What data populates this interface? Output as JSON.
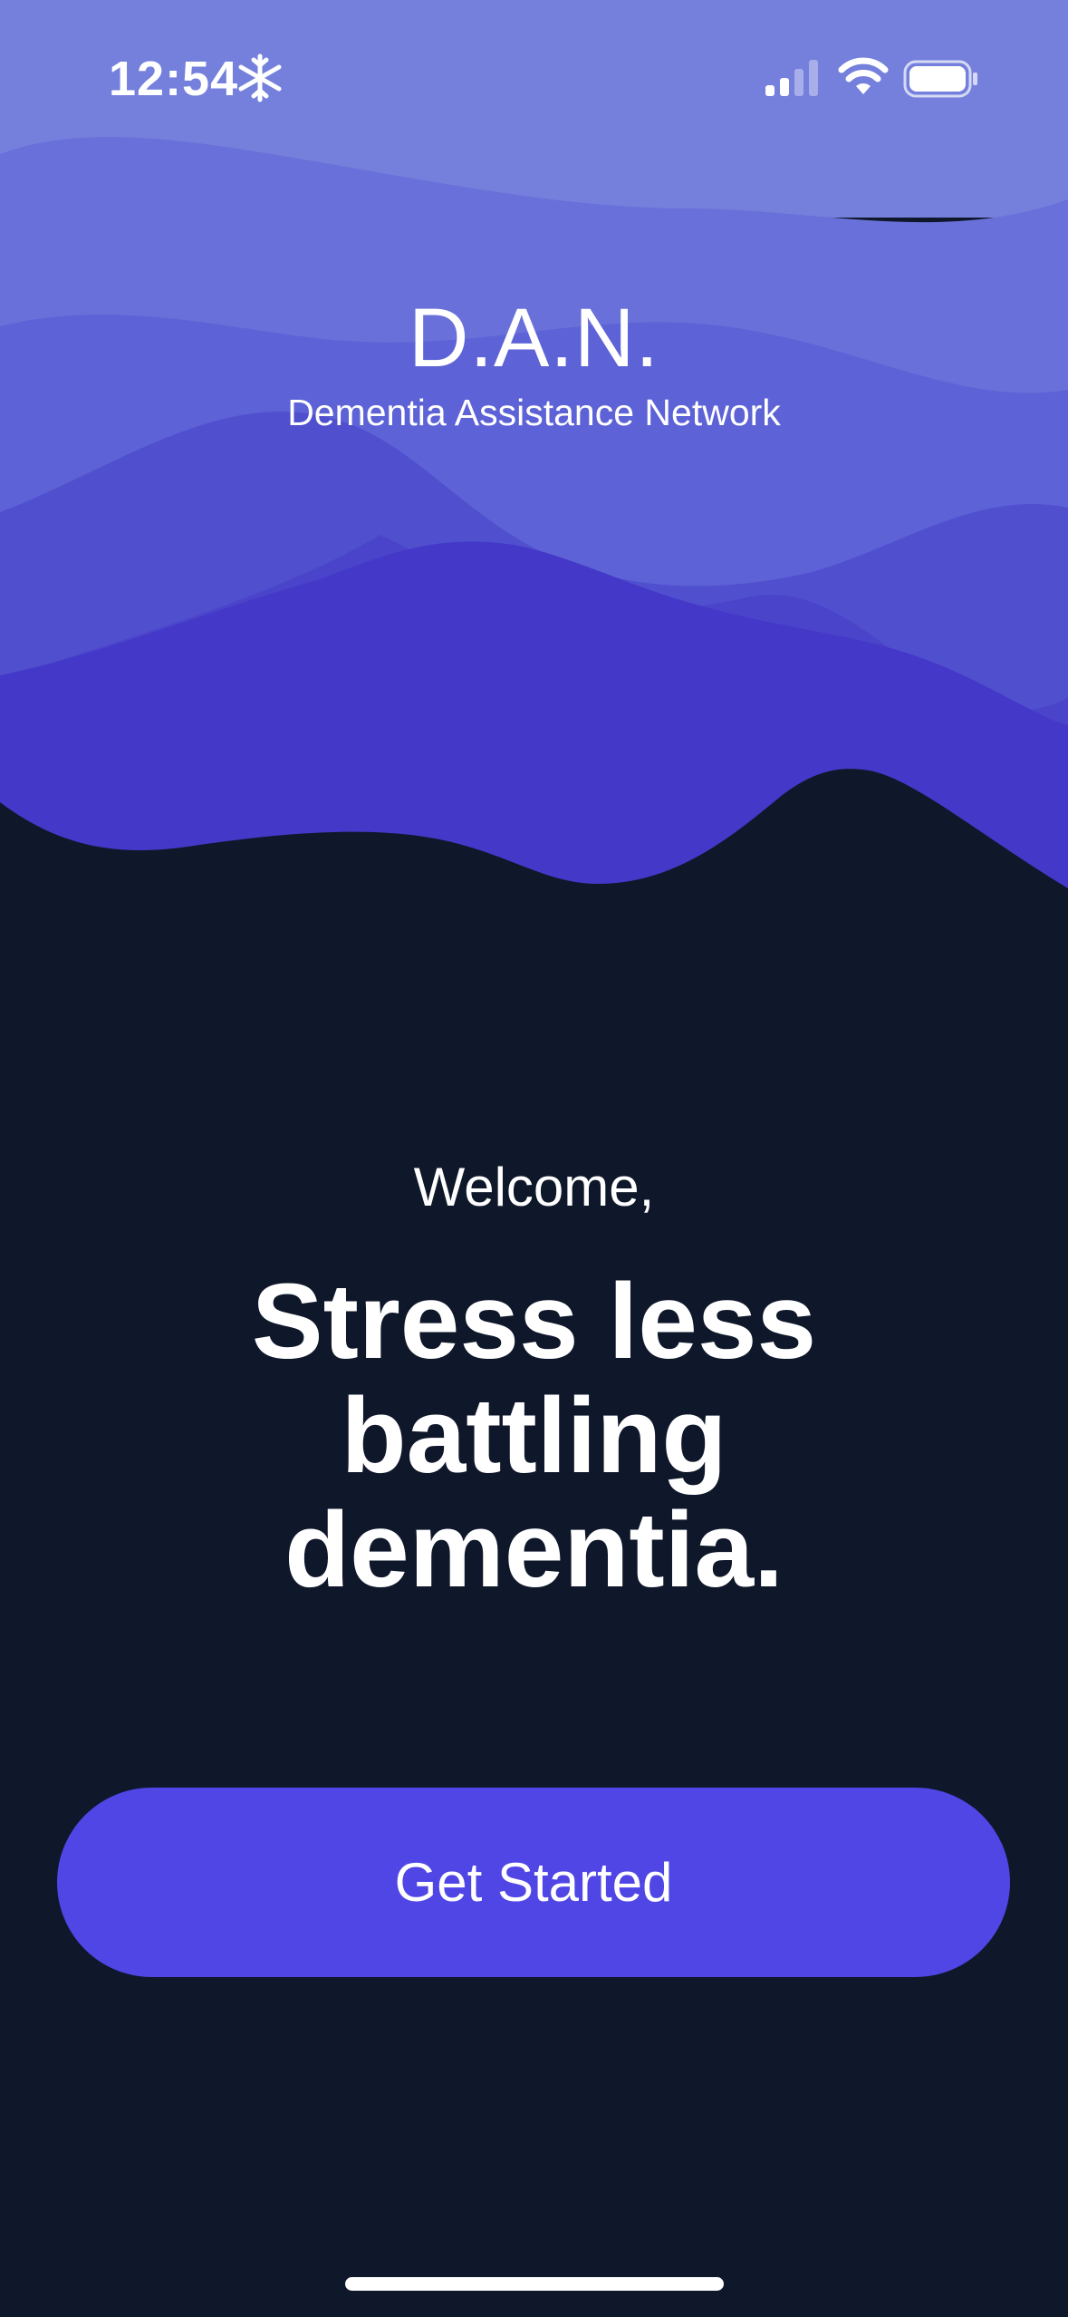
{
  "status_bar": {
    "time": "12:54",
    "time_suffix_icon": "snowflake-icon",
    "signal_icon": "cellular-signal-icon",
    "wifi_icon": "wifi-icon",
    "battery_icon": "battery-icon"
  },
  "brand": {
    "title": "D.A.N.",
    "subtitle": "Dementia Assistance Network"
  },
  "hero": {
    "welcome": "Welcome,",
    "headline": "Stress less battling dementia."
  },
  "cta": {
    "label": "Get Started"
  },
  "colors": {
    "background": "#0f172a",
    "accent": "#4f46e5",
    "wave_light": "#747fdc",
    "wave_mid": "#5b5fd6",
    "wave_deep": "#4438c9"
  }
}
